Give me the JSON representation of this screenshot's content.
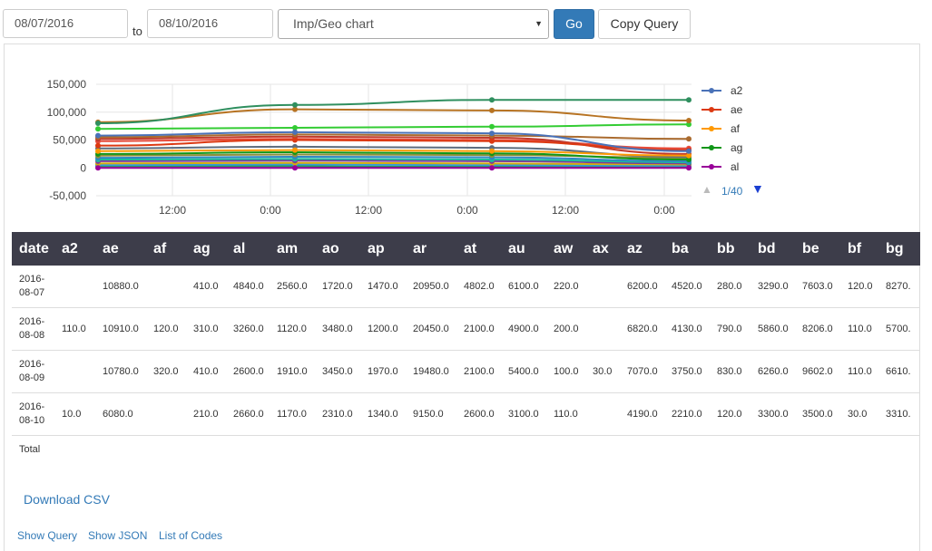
{
  "toolbar": {
    "start_date": "08/07/2016",
    "to_label": "to",
    "end_date": "08/10/2016",
    "chart_select": "Imp/Geo chart",
    "go_label": "Go",
    "copy_label": "Copy Query"
  },
  "chart_data": {
    "type": "line",
    "x_tick_labels": [
      "12:00",
      "0:00",
      "12:00",
      "0:00",
      "12:00",
      "0:00"
    ],
    "y_tick_labels": [
      "150,000",
      "100,000",
      "50,000",
      "0",
      "-50,000"
    ],
    "y_ticks": [
      150000,
      100000,
      50000,
      0,
      -50000
    ],
    "ylim": [
      -50000,
      150000
    ],
    "x": [
      "2016-08-07",
      "2016-08-08",
      "2016-08-09",
      "2016-08-10"
    ],
    "series": [
      {
        "name": "a2",
        "color": "#4a72b8",
        "values": [
          58000,
          64000,
          62000,
          30000
        ]
      },
      {
        "name": "ae",
        "color": "#dc3912",
        "values": [
          40000,
          50000,
          48000,
          32000
        ]
      },
      {
        "name": "af",
        "color": "#ff9900",
        "values": [
          30000,
          32000,
          30000,
          22000
        ]
      },
      {
        "name": "ag",
        "color": "#109618",
        "values": [
          25000,
          28000,
          26000,
          15000
        ]
      },
      {
        "name": "al",
        "color": "#990099",
        "values": [
          0,
          0,
          0,
          0
        ]
      },
      {
        "values": [
          80000,
          113000,
          122000,
          122000
        ],
        "color": "#2f8f5f"
      },
      {
        "values": [
          82000,
          105000,
          103000,
          85000
        ],
        "color": "#b77322"
      },
      {
        "values": [
          70000,
          72000,
          74000,
          78000
        ],
        "color": "#33cc33"
      },
      {
        "values": [
          55000,
          60000,
          58000,
          52000
        ],
        "color": "#aa6b2f"
      },
      {
        "values": [
          52000,
          56000,
          54000,
          25000
        ],
        "color": "#c0392b"
      },
      {
        "values": [
          48000,
          52000,
          50000,
          35000
        ],
        "color": "#e74c3c"
      },
      {
        "values": [
          35000,
          38000,
          36000,
          20000
        ],
        "color": "#5d6d7e"
      },
      {
        "values": [
          22000,
          24000,
          23000,
          18000
        ],
        "color": "#8e8e3a"
      },
      {
        "values": [
          18000,
          20000,
          19000,
          12000
        ],
        "color": "#2e86c1"
      },
      {
        "values": [
          15000,
          16000,
          15000,
          10000
        ],
        "color": "#1abc9c"
      },
      {
        "values": [
          12000,
          13000,
          12000,
          8000
        ],
        "color": "#7d3c98"
      },
      {
        "values": [
          8000,
          9000,
          8000,
          6000
        ],
        "color": "#d4ac0d"
      },
      {
        "values": [
          5000,
          6000,
          5000,
          4000
        ],
        "color": "#3498db"
      },
      {
        "values": [
          3000,
          3000,
          2000,
          2000
        ],
        "color": "#239b56"
      }
    ]
  },
  "legend": {
    "items": [
      {
        "label": "a2",
        "color": "#4a72b8"
      },
      {
        "label": "ae",
        "color": "#dc3912"
      },
      {
        "label": "af",
        "color": "#ff9900"
      },
      {
        "label": "ag",
        "color": "#109618"
      },
      {
        "label": "al",
        "color": "#990099"
      }
    ],
    "page_text": "1/40",
    "up_glyph": "▲",
    "down_glyph": "▼"
  },
  "table": {
    "headers": [
      "date",
      "a2",
      "ae",
      "af",
      "ag",
      "al",
      "am",
      "ao",
      "ap",
      "ar",
      "at",
      "au",
      "aw",
      "ax",
      "az",
      "ba",
      "bb",
      "bd",
      "be",
      "bf",
      "bg"
    ],
    "rows": [
      [
        "2016-08-07",
        "",
        "10880.0",
        "",
        "410.0",
        "4840.0",
        "2560.0",
        "1720.0",
        "1470.0",
        "20950.0",
        "4802.0",
        "6100.0",
        "220.0",
        "",
        "6200.0",
        "4520.0",
        "280.0",
        "3290.0",
        "7603.0",
        "120.0",
        "8270."
      ],
      [
        "2016-08-08",
        "110.0",
        "10910.0",
        "120.0",
        "310.0",
        "3260.0",
        "1120.0",
        "3480.0",
        "1200.0",
        "20450.0",
        "2100.0",
        "4900.0",
        "200.0",
        "",
        "6820.0",
        "4130.0",
        "790.0",
        "5860.0",
        "8206.0",
        "110.0",
        "5700."
      ],
      [
        "2016-08-09",
        "",
        "10780.0",
        "320.0",
        "410.0",
        "2600.0",
        "1910.0",
        "3450.0",
        "1970.0",
        "19480.0",
        "2100.0",
        "5400.0",
        "100.0",
        "30.0",
        "7070.0",
        "3750.0",
        "830.0",
        "6260.0",
        "9602.0",
        "110.0",
        "6610."
      ],
      [
        "2016-08-10",
        "10.0",
        "6080.0",
        "",
        "210.0",
        "2660.0",
        "1170.0",
        "2310.0",
        "1340.0",
        "9150.0",
        "2600.0",
        "3100.0",
        "110.0",
        "",
        "4190.0",
        "2210.0",
        "120.0",
        "3300.0",
        "3500.0",
        "30.0",
        "3310."
      ]
    ],
    "total_label": "Total"
  },
  "links": {
    "download_csv": "Download CSV",
    "show_query": "Show Query",
    "show_json": "Show JSON",
    "list_of_codes": "List of Codes"
  }
}
